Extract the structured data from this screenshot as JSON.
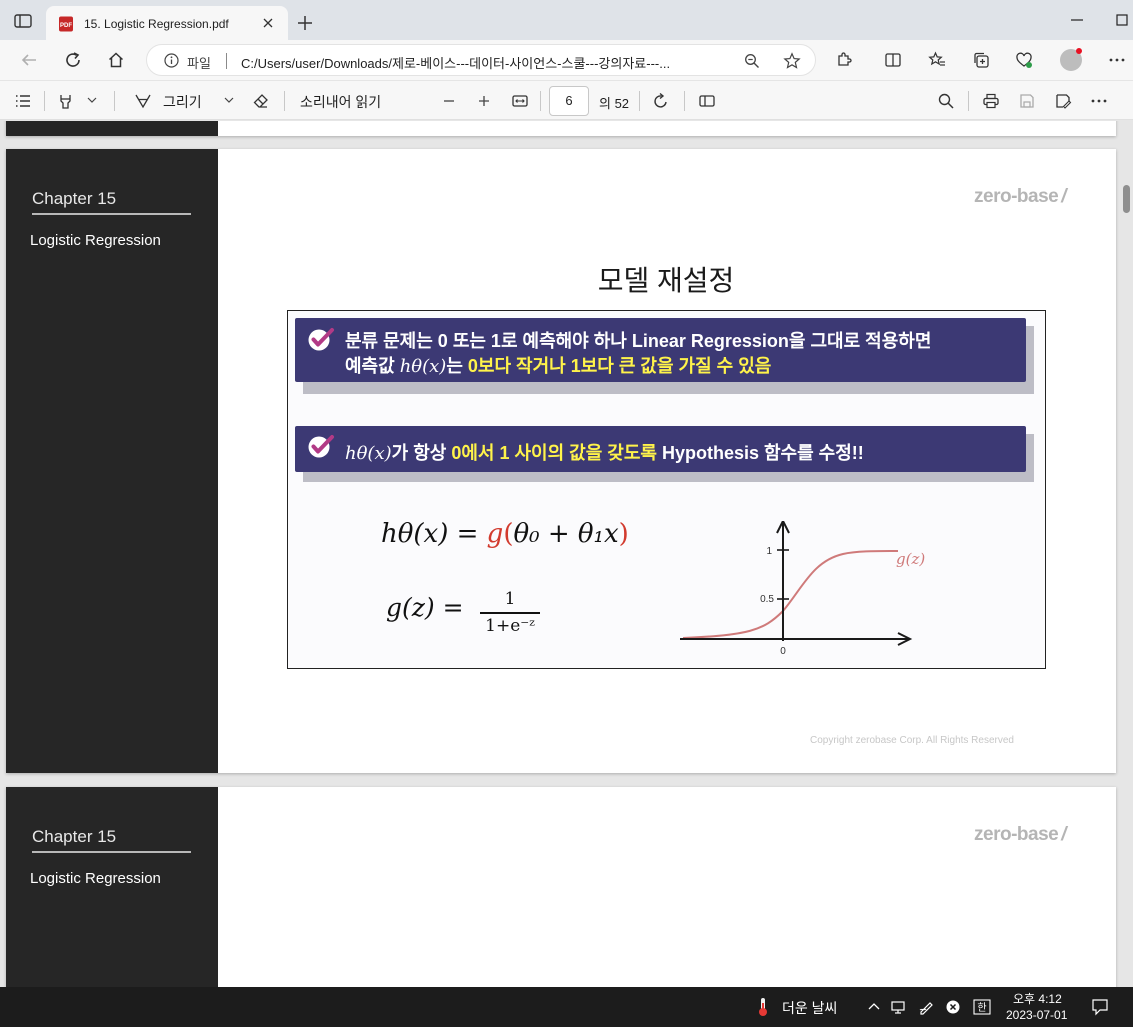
{
  "browser": {
    "tab": {
      "title": "15. Logistic Regression.pdf",
      "favicon": "PDF"
    },
    "address": {
      "file_label": "파일",
      "url": "C:/Users/user/Downloads/제로-베이스---데이터-사이언스-스쿨---강의자료---..."
    }
  },
  "pdf_toolbar": {
    "draw_label": "그리기",
    "read_aloud_label": "소리내어 읽기",
    "page_current": "6",
    "page_total": "의 52"
  },
  "pages": [
    {
      "chapter": "Chapter   15",
      "subject": "Logistic Regression",
      "brand": "zero-base",
      "brand_slash": "/",
      "title": "모델 재설정",
      "banner1": {
        "line1": "분류 문제는 0 또는 1로 예측해야 하나 Linear Regression을 그대로 적용하면",
        "line2_prefix": "예측값 ",
        "line2_math": "hθ(x)",
        "line2_mid": "는 ",
        "line2_highlight": "0보다 작거나 1보다 큰 값을 가질 수 있음"
      },
      "banner2": {
        "math": "hθ(x)",
        "prefix": "가 항상 ",
        "highlight": "0에서 1 사이의 값을 갖도록",
        "suffix": " Hypothesis 함수를 수정!!"
      },
      "equation1": {
        "lhs": "hθ(x) = ",
        "g": "g",
        "open": "(",
        "body": "θ₀ + θ₁x",
        "close": ")"
      },
      "equation2": {
        "lhs": "g(z) = ",
        "numerator": "1",
        "denominator": "1+e⁻ᶻ"
      },
      "plot_labels": {
        "y_one": "1",
        "y_half": "0.5",
        "x_zero": "0",
        "curve": "g(z)"
      },
      "copyright": "Copyright zerobase Corp. All Rights Reserved"
    },
    {
      "chapter": "Chapter   15",
      "subject": "Logistic Regression",
      "brand": "zero-base",
      "brand_slash": "/"
    }
  ],
  "taskbar": {
    "weather": "더운 날씨",
    "time": "오후 4:12",
    "date": "2023-07-01",
    "ime": "한"
  },
  "colors": {
    "banner": "#3c3974",
    "highlight": "#fff34a",
    "accent_red": "#d23b2f",
    "sidebar": "#262626"
  }
}
